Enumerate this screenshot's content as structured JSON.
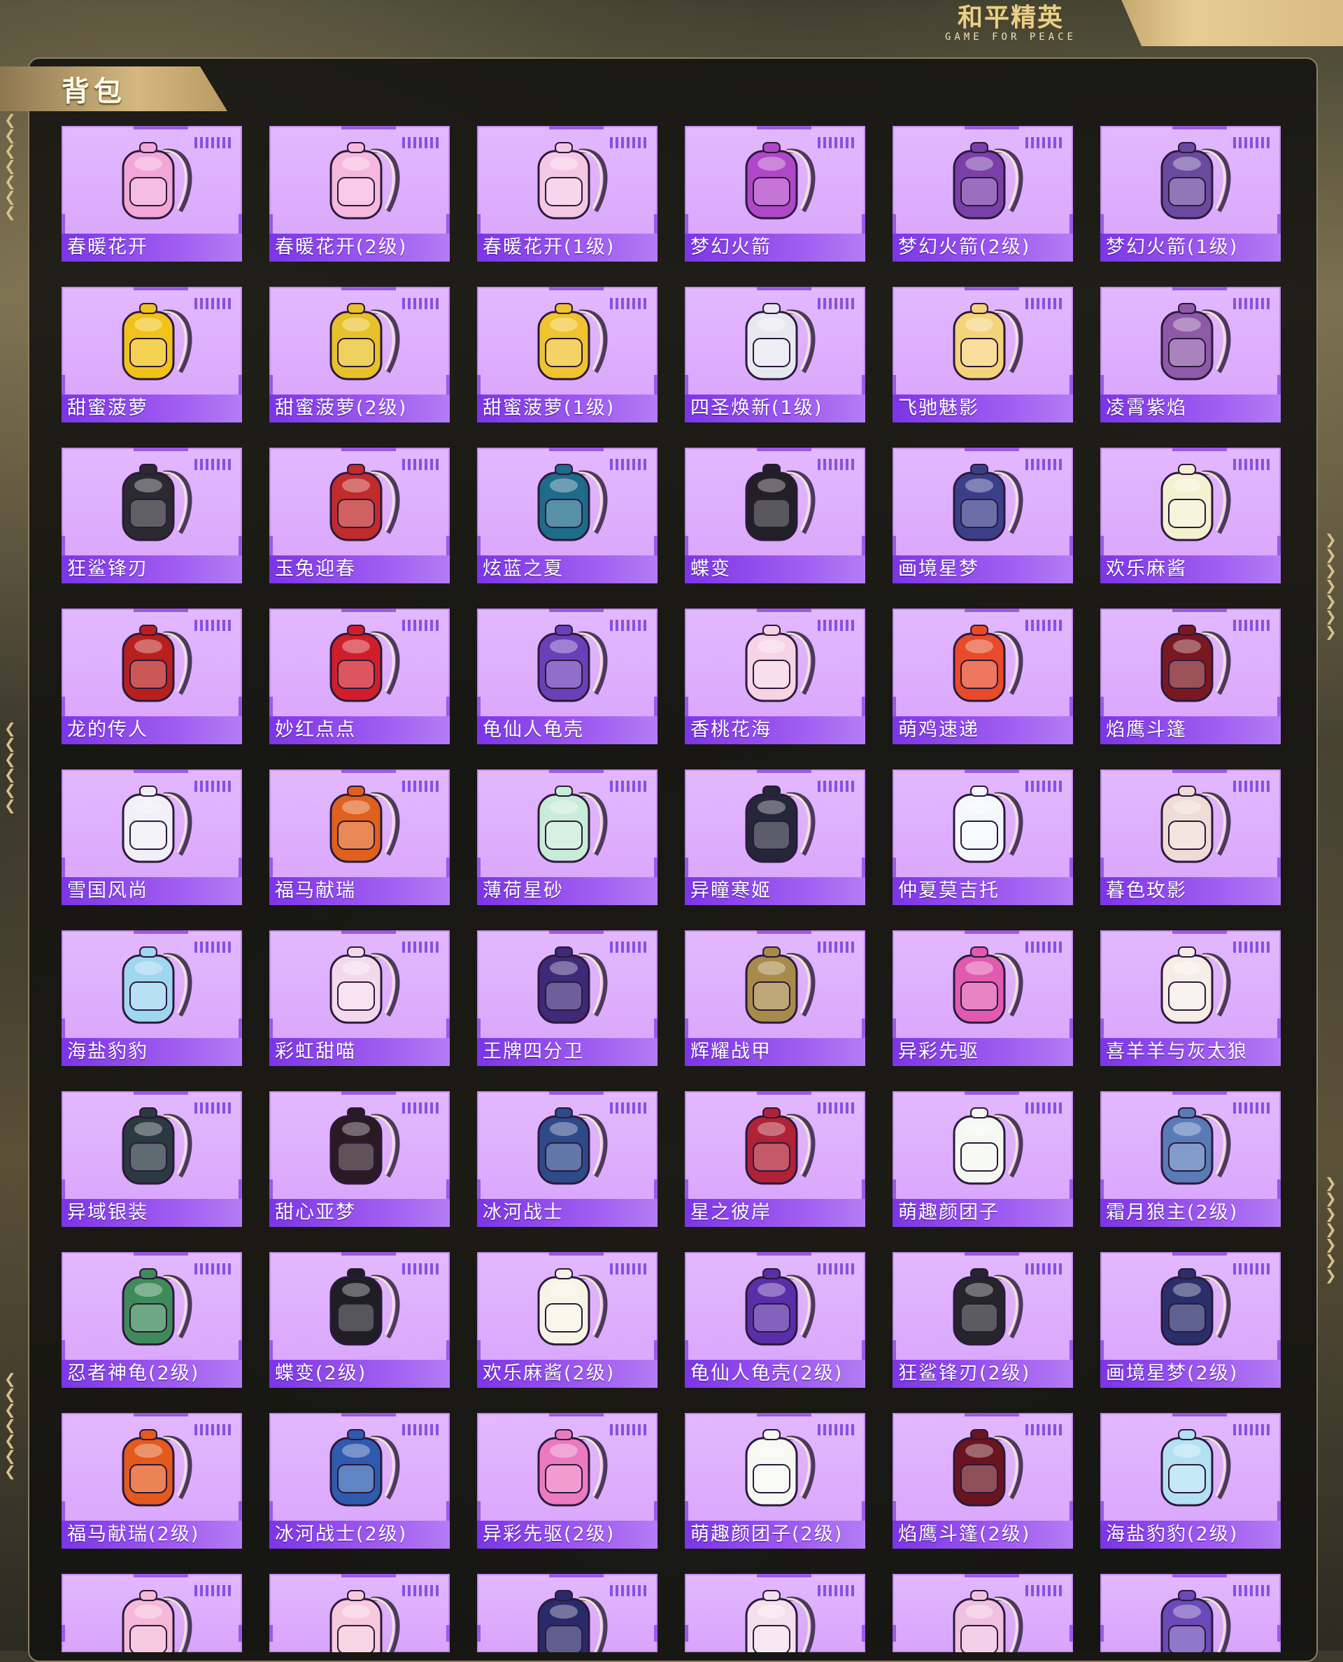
{
  "header": {
    "logo_cn": "和平精英",
    "logo_en": "GAME FOR PEACE"
  },
  "panel": {
    "title": "背包"
  },
  "colors": {
    "tile_bg": "#dca9fd",
    "label_bg": "#8a45ea",
    "accent_gold": "#d4b87f"
  },
  "items": [
    {
      "name": "春暖花开",
      "color": "#f2a7d8"
    },
    {
      "name": "春暖花开(2级)",
      "color": "#f6b8df"
    },
    {
      "name": "春暖花开(1级)",
      "color": "#f4c8e4"
    },
    {
      "name": "梦幻火箭",
      "color": "#b047c8"
    },
    {
      "name": "梦幻火箭(2级)",
      "color": "#7a3fa8"
    },
    {
      "name": "梦幻火箭(1级)",
      "color": "#6a4aa0"
    },
    {
      "name": "甜蜜菠萝",
      "color": "#f2c21a"
    },
    {
      "name": "甜蜜菠萝(2级)",
      "color": "#e8c12a"
    },
    {
      "name": "甜蜜菠萝(1级)",
      "color": "#f0c330"
    },
    {
      "name": "四圣焕新(1级)",
      "color": "#e8e8f0"
    },
    {
      "name": "飞驰魅影",
      "color": "#f4d37a"
    },
    {
      "name": "凌霄紫焰",
      "color": "#8e5aa8"
    },
    {
      "name": "狂鲨锋刃",
      "color": "#2b2a30"
    },
    {
      "name": "玉兔迎春",
      "color": "#c22b2b"
    },
    {
      "name": "炫蓝之夏",
      "color": "#1f6b8a"
    },
    {
      "name": "蝶变",
      "color": "#222026"
    },
    {
      "name": "画境星梦",
      "color": "#3b3f8a"
    },
    {
      "name": "欢乐麻酱",
      "color": "#f3f1d0"
    },
    {
      "name": "龙的传人",
      "color": "#b8201e"
    },
    {
      "name": "妙红点点",
      "color": "#d01e2a"
    },
    {
      "name": "龟仙人龟壳",
      "color": "#6b3fb8"
    },
    {
      "name": "香桃花海",
      "color": "#f7d3e6"
    },
    {
      "name": "萌鸡速递",
      "color": "#e84a2a"
    },
    {
      "name": "焰鹰斗篷",
      "color": "#7a1822"
    },
    {
      "name": "雪国风尚",
      "color": "#f0f0f6"
    },
    {
      "name": "福马献瑞",
      "color": "#e0601e"
    },
    {
      "name": "薄荷星砂",
      "color": "#c8ecd8"
    },
    {
      "name": "异瞳寒姬",
      "color": "#26263a"
    },
    {
      "name": "仲夏莫吉托",
      "color": "#f4f8fb"
    },
    {
      "name": "暮色玫影",
      "color": "#f0dcd6"
    },
    {
      "name": "海盐豹豹",
      "color": "#9fd6f0"
    },
    {
      "name": "彩虹甜喵",
      "color": "#f4d9ec"
    },
    {
      "name": "王牌四分卫",
      "color": "#3e2a78"
    },
    {
      "name": "辉耀战甲",
      "color": "#a88a4a"
    },
    {
      "name": "异彩先驱",
      "color": "#e05ab0"
    },
    {
      "name": "喜羊羊与灰太狼",
      "color": "#f6eee6"
    },
    {
      "name": "异域银装",
      "color": "#2a3a40"
    },
    {
      "name": "甜心亚梦",
      "color": "#2a1a22"
    },
    {
      "name": "冰河战士",
      "color": "#2e4a8a"
    },
    {
      "name": "星之彼岸",
      "color": "#b02238"
    },
    {
      "name": "萌趣颜团子",
      "color": "#f4f8f0"
    },
    {
      "name": "霜月狼主(2级)",
      "color": "#5a7ab8"
    },
    {
      "name": "忍者神龟(2级)",
      "color": "#3e8a5a"
    },
    {
      "name": "蝶变(2级)",
      "color": "#1e1e24"
    },
    {
      "name": "欢乐麻酱(2级)",
      "color": "#f6f4e4"
    },
    {
      "name": "龟仙人龟壳(2级)",
      "color": "#5a2ea8"
    },
    {
      "name": "狂鲨锋刃(2级)",
      "color": "#25252c"
    },
    {
      "name": "画境星梦(2级)",
      "color": "#2a2e6a"
    },
    {
      "name": "福马献瑞(2级)",
      "color": "#e45a1e"
    },
    {
      "name": "冰河战士(2级)",
      "color": "#2e5ab0"
    },
    {
      "name": "异彩先驱(2级)",
      "color": "#ec7ac0"
    },
    {
      "name": "萌趣颜团子(2级)",
      "color": "#f6f8f2"
    },
    {
      "name": "焰鹰斗篷(2级)",
      "color": "#6a1420"
    },
    {
      "name": "海盐豹豹(2级)",
      "color": "#b4e0f4"
    },
    {
      "name": "",
      "color": "#f6b8d8"
    },
    {
      "name": "",
      "color": "#f8c8dc"
    },
    {
      "name": "",
      "color": "#2a2a6a"
    },
    {
      "name": "",
      "color": "#f4e0ec"
    },
    {
      "name": "",
      "color": "#f0c0e0"
    },
    {
      "name": "",
      "color": "#6a4ab8"
    }
  ]
}
